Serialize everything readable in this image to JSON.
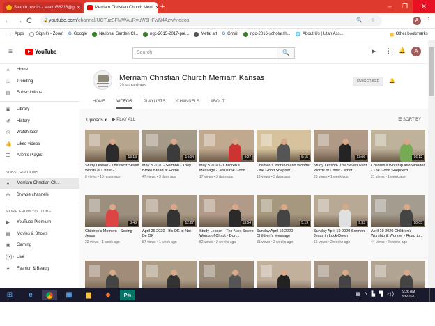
{
  "browser": {
    "tabs": [
      {
        "label": "Search results - avattoB6216@g",
        "close": "✕"
      },
      {
        "label": "Merriam Christian Church Merri",
        "close": "✕"
      }
    ],
    "new_tab": "+",
    "url_host": "youtube.com",
    "url_path": "/channel/UCTuzSFMWAuRvuW6HFwN4Azw/videos",
    "bookmarks": [
      "Apps",
      "Sign In - Zoom",
      "Google",
      "National Garden Cl...",
      "ngc-2015-2017-pre...",
      "Metal art",
      "Gmail",
      "ngc-2016-scholarsh...",
      "About Us | Utah Ass..."
    ],
    "other_bookmarks": "Other bookmarks",
    "avatar_letter": "A"
  },
  "youtube": {
    "logo": "YouTube",
    "search_placeholder": "Search",
    "avatar_letter": "A"
  },
  "sidebar": {
    "top": [
      {
        "icon": "home-icon",
        "glyph": "⌂",
        "label": "Home"
      },
      {
        "icon": "trending-icon",
        "glyph": "♨",
        "label": "Trending"
      },
      {
        "icon": "subscriptions-icon",
        "glyph": "▤",
        "label": "Subscriptions"
      }
    ],
    "library": [
      {
        "icon": "library-icon",
        "glyph": "▣",
        "label": "Library"
      },
      {
        "icon": "history-icon",
        "glyph": "↺",
        "label": "History"
      },
      {
        "icon": "watch-later-icon",
        "glyph": "◷",
        "label": "Watch later"
      },
      {
        "icon": "liked-icon",
        "glyph": "👍",
        "label": "Liked videos"
      },
      {
        "icon": "playlist-icon",
        "glyph": "☰",
        "label": "Allen's Playlist"
      }
    ],
    "subs_header": "SUBSCRIPTIONS",
    "subs": [
      {
        "icon": "channel-avatar-icon",
        "glyph": "●",
        "label": "Merriam Christian Ch..."
      },
      {
        "icon": "browse-icon",
        "glyph": "⊕",
        "label": "Browse channels"
      }
    ],
    "more_header": "MORE FROM YOUTUBE",
    "more": [
      {
        "icon": "premium-icon",
        "glyph": "▶",
        "label": "YouTube Premium"
      },
      {
        "icon": "movies-icon",
        "glyph": "▦",
        "label": "Movies & Shows"
      },
      {
        "icon": "gaming-icon",
        "glyph": "◉",
        "label": "Gaming"
      },
      {
        "icon": "live-icon",
        "glyph": "((•))",
        "label": "Live"
      },
      {
        "icon": "fashion-icon",
        "glyph": "✦",
        "label": "Fashion & Beauty"
      }
    ]
  },
  "channel": {
    "name": "Merriam Christian Church Merriam Kansas",
    "subscribers": "29 subscribers",
    "subscribed": "SUBSCRIBED",
    "tabs": [
      "HOME",
      "VIDEOS",
      "PLAYLISTS",
      "CHANNELS",
      "ABOUT"
    ],
    "uploads": "Uploads ▾",
    "play_all": "PLAY ALL",
    "sort_by": "SORT BY"
  },
  "videos": [
    {
      "title": "Study Lesson - The Next Seven Words of Christ -...",
      "meta": "8 views • 16 hours ago",
      "duration": "13:13",
      "bg": "#b7a48c"
    },
    {
      "title": "May 3 2020 - Sermon - They Broke Bread at Home",
      "meta": "47 views • 3 days ago",
      "duration": "14:04",
      "bg": "#a59987"
    },
    {
      "title": "May 3 2020 - Children's Message - Jesus the Good...",
      "meta": "17 views • 3 days ago",
      "duration": "4:27",
      "bg": "#c1a98f"
    },
    {
      "title": "Children's Worship and Wonder - the Good Shepher...",
      "meta": "13 views • 3 days ago",
      "duration": "5:15",
      "bg": "#d6c29c"
    },
    {
      "title": "Study Lesson- The Seven Next Words of Christ - What...",
      "meta": "25 views • 1 week ago",
      "duration": "13:06",
      "bg": "#b09a86"
    },
    {
      "title": "Children's Worship and Wonder - The Good Shepherd",
      "meta": "21 views • 1 week ago",
      "duration": "16:12",
      "bg": "#bfb29a"
    },
    {
      "title": "Children's Moment - Seeing Jesus",
      "meta": "32 views • 1 week ago",
      "duration": "8:48",
      "bg": "#9d8f7e"
    },
    {
      "title": "April 26 2020 - It's OK to Not Be OK",
      "meta": "57 views • 1 week ago",
      "duration": "12:27",
      "bg": "#a89986"
    },
    {
      "title": "Study Lesson - The Next Seven Words of Christ - Don...",
      "meta": "52 views • 2 weeks ago",
      "duration": "13:54",
      "bg": "#b19b88"
    },
    {
      "title": "Sunday April 19 2020 Children's Message",
      "meta": "31 views • 2 weeks ago",
      "duration": "5:19",
      "bg": "#a6977f"
    },
    {
      "title": "Sunday April 19 2020 Sermon - Jesus in Lock-Down",
      "meta": "65 views • 2 weeks ago",
      "duration": "9:33",
      "bg": "#b8a995"
    },
    {
      "title": "April 19 2020 Children's Worship & Wonder - Road to...",
      "meta": "44 views • 2 weeks ago",
      "duration": "10:05",
      "bg": "#a39c8f"
    },
    {
      "title": "",
      "meta": "",
      "duration": "",
      "bg": "#a08c78"
    },
    {
      "title": "",
      "meta": "",
      "duration": "",
      "bg": "#ad9d86"
    },
    {
      "title": "",
      "meta": "",
      "duration": "",
      "bg": "#9a8a78"
    },
    {
      "title": "",
      "meta": "",
      "duration": "",
      "bg": "#c0b09c"
    },
    {
      "title": "",
      "meta": "",
      "duration": "",
      "bg": "#a49483"
    },
    {
      "title": "",
      "meta": "",
      "duration": "",
      "bg": "#b2a493"
    }
  ],
  "taskbar": {
    "time": "9:26 AM",
    "date": "5/8/2020"
  }
}
